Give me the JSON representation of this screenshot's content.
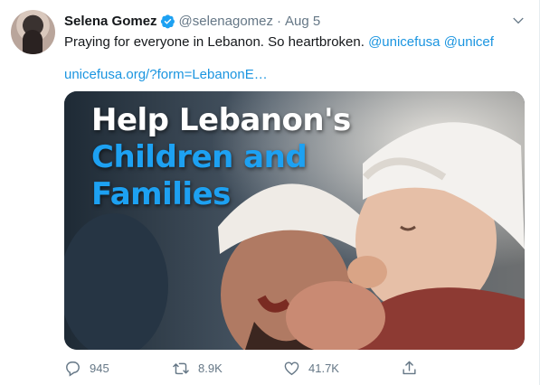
{
  "user": {
    "name": "Selena Gomez",
    "handle": "@selenagomez",
    "separator": "·",
    "date": "Aug 5"
  },
  "tweet": {
    "text_before": "Praying for everyone in Lebanon. So heartbroken. ",
    "mention1": "@unicefusa",
    "space": " ",
    "mention2": "@unicef",
    "link": "unicefusa.org/?form=LebanonE…"
  },
  "card": {
    "line1": "Help Lebanon's",
    "line2": "Children and",
    "line3": "Families"
  },
  "actions": {
    "replies": "945",
    "retweets": "8.9K",
    "likes": "41.7K"
  },
  "colors": {
    "accent": "#1b95e0",
    "card_heading_blue": "#1da1f2",
    "muted": "#657786"
  },
  "icons": [
    "verified-badge-icon",
    "chevron-down-icon",
    "reply-icon",
    "retweet-icon",
    "like-icon",
    "share-icon"
  ]
}
